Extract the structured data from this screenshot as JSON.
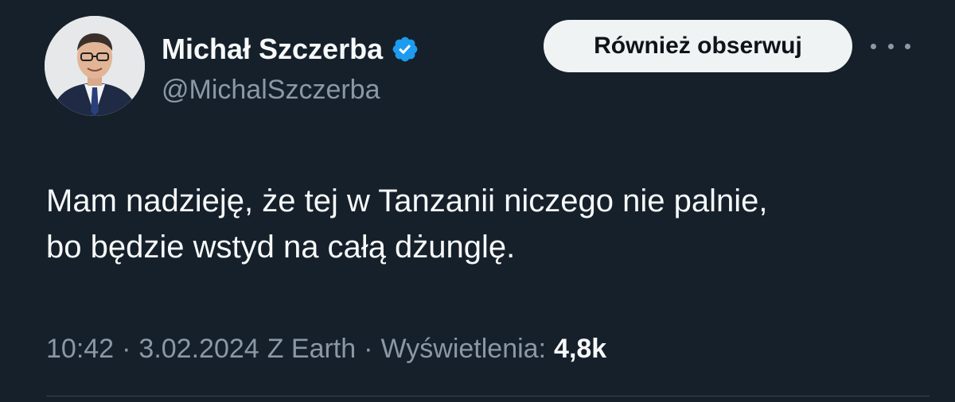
{
  "colors": {
    "background": "#15202b",
    "text_primary": "#f7f9f9",
    "text_secondary": "#8b98a5",
    "verified_badge": "#1d9bf0",
    "follow_button_bg": "#eff3f4",
    "follow_button_text": "#0f1419"
  },
  "author": {
    "display_name": "Michał Szczerba",
    "handle": "@MichalSzczerba",
    "verified": true,
    "verified_icon": "verified-badge-icon",
    "avatar_icon": "profile-photo"
  },
  "actions": {
    "follow_label": "Również obserwuj",
    "more_icon": "more-options-icon"
  },
  "tweet": {
    "lines": [
      "Mam nadzieję, że tej w Tanzanii niczego nie palnie,",
      "bo będzie wstyd na całą dżunglę."
    ]
  },
  "meta": {
    "time": "10:42",
    "date": "3.02.2024",
    "source": "Z Earth",
    "views_label": "Wyświetlenia:",
    "views_count": "4,8k",
    "separator": "·"
  }
}
